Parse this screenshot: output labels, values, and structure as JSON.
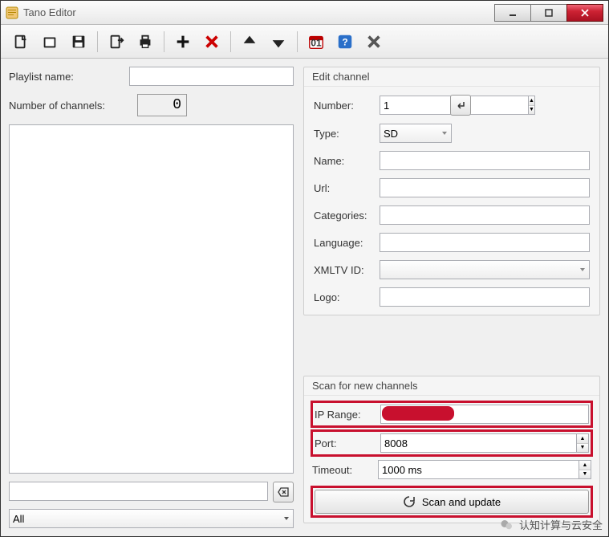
{
  "title": "Tano Editor",
  "toolbar": {
    "new": "New",
    "open": "Open",
    "save": "Save",
    "export": "Export",
    "print": "Print",
    "add": "Add",
    "remove": "Remove",
    "up": "Up",
    "down": "Down",
    "schedule": "Schedule",
    "help": "Help",
    "close": "Close"
  },
  "left": {
    "playlist_label": "Playlist name:",
    "playlist_value": "",
    "channels_label": "Number of channels:",
    "channels_value": "0",
    "filter_value": "",
    "category_combo": "All"
  },
  "edit": {
    "group_title": "Edit channel",
    "number_label": "Number:",
    "number_value": "1",
    "type_label": "Type:",
    "type_value": "SD",
    "name_label": "Name:",
    "name_value": "",
    "url_label": "Url:",
    "url_value": "",
    "categories_label": "Categories:",
    "categories_value": "",
    "language_label": "Language:",
    "language_value": "",
    "xmltv_label": "XMLTV ID:",
    "xmltv_value": "",
    "logo_label": "Logo:",
    "logo_value": ""
  },
  "scan": {
    "group_title": "Scan for new channels",
    "ip_label": "IP Range:",
    "ip_value": "",
    "port_label": "Port:",
    "port_value": "8008",
    "timeout_label": "Timeout:",
    "timeout_value": "1000 ms",
    "button": "Scan and update"
  },
  "footer_text": "认知计算与云安全"
}
